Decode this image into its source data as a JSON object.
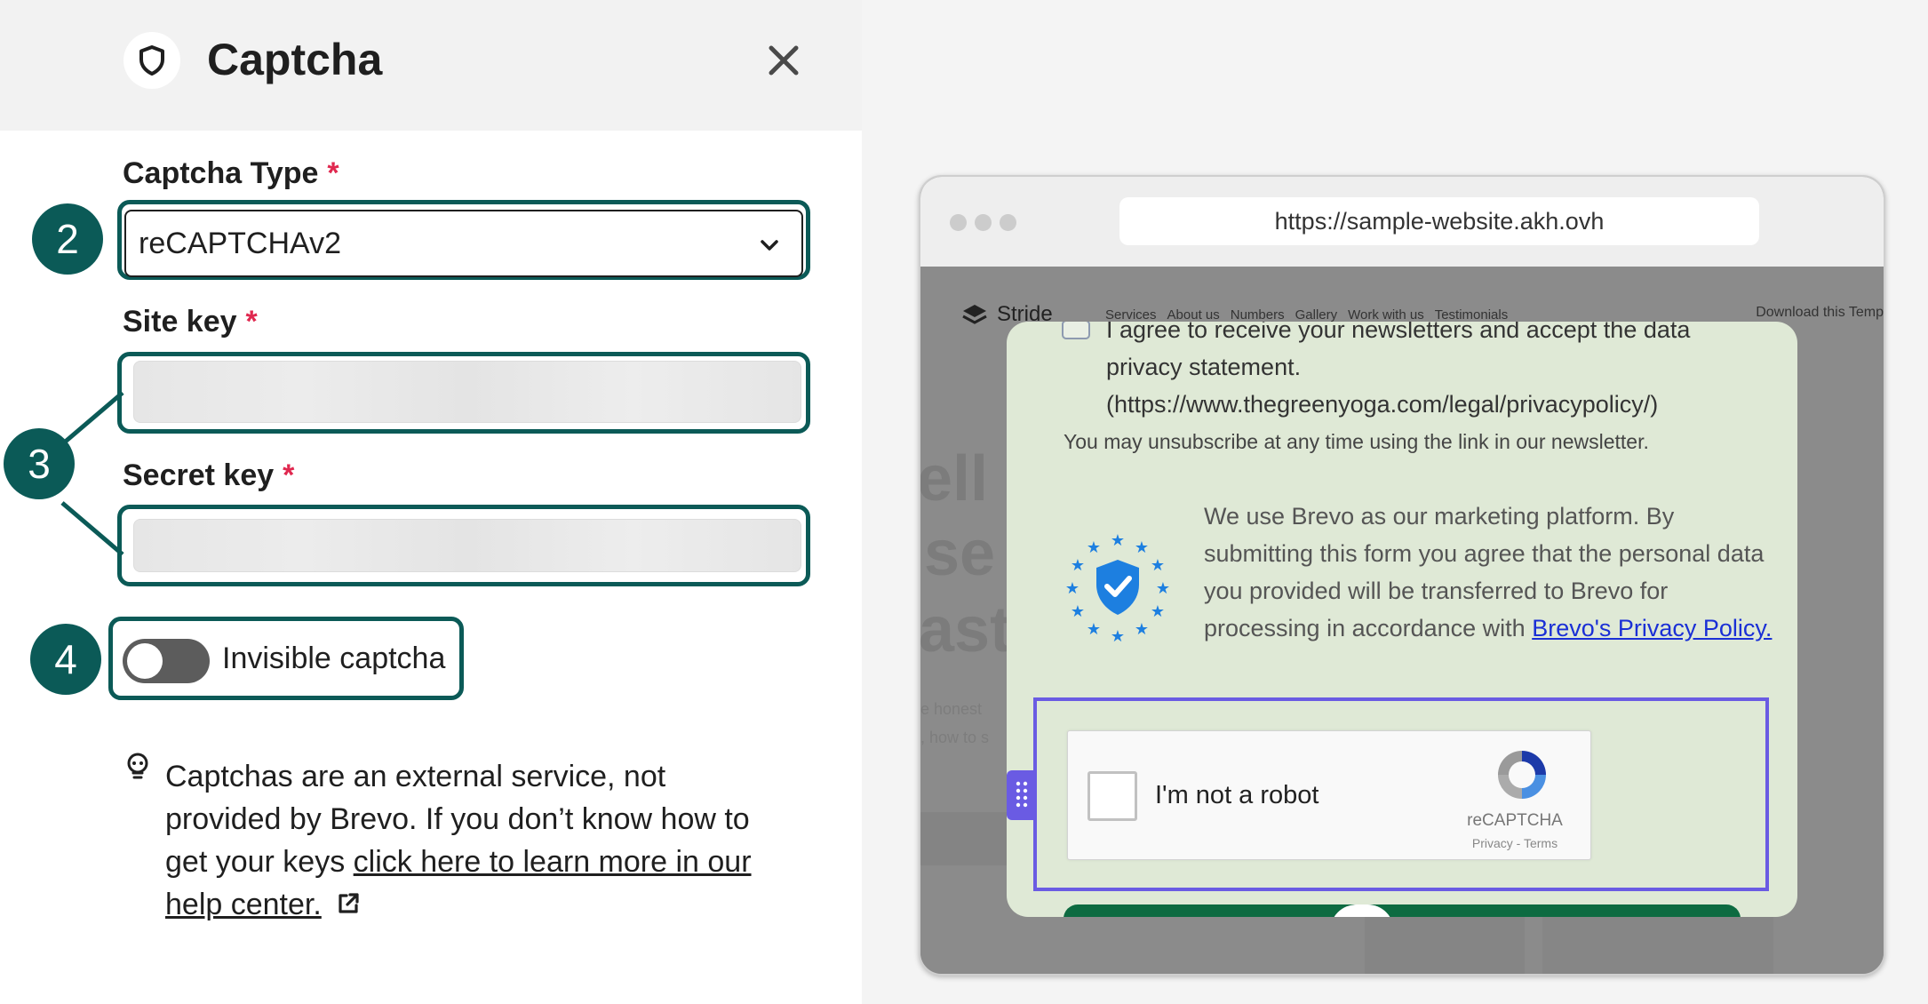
{
  "panel": {
    "title": "Captcha",
    "header_icon": "shield-icon",
    "close_icon": "close-icon"
  },
  "fields": {
    "captcha_type_label": "Captcha Type",
    "captcha_type_value": "reCAPTCHAv2",
    "site_key_label": "Site key",
    "secret_key_label": "Secret key",
    "required_marker": "*"
  },
  "badges": {
    "step2": "2",
    "step3": "3",
    "step4": "4"
  },
  "toggle": {
    "label": "Invisible captcha",
    "state": "off"
  },
  "info": {
    "icon": "lightbulb-icon",
    "text": "Captchas are an external service, not provided by Brevo. If you don’t know how to get your keys ",
    "link": "click here to learn more in our help center.",
    "link_icon": "external-link-icon"
  },
  "browser": {
    "url": "https://sample-website.akh.ovh",
    "site_name": "Stride",
    "nav": [
      "Services",
      "About us",
      "Numbers",
      "Gallery",
      "Work with us",
      "Testimonials"
    ],
    "download": "Download this Temp"
  },
  "popup": {
    "consent_text": "I agree to receive your newsletters and accept the data privacy statement. (https://www.thegreenyoga.com/legal/privacypolicy/)",
    "unsubscribe_text": "You may unsubscribe at any time using the link in our newsletter.",
    "brevo_text": "We use Brevo as our marketing platform. By submitting this form you agree that the personal data you provided will be transferred to Brevo for processing in accordance with ",
    "brevo_link": "Brevo's Privacy Policy.",
    "recaptcha_label": "I'm not a robot",
    "recaptcha_brand": "reCAPTCHA",
    "recaptcha_terms": "Privacy - Terms"
  },
  "colors": {
    "accent": "#0b5a57",
    "required": "#e0284f",
    "popup_bg": "#dfe9d6",
    "recaptcha_frame": "#6a5be3",
    "link": "#1a2fd6"
  }
}
